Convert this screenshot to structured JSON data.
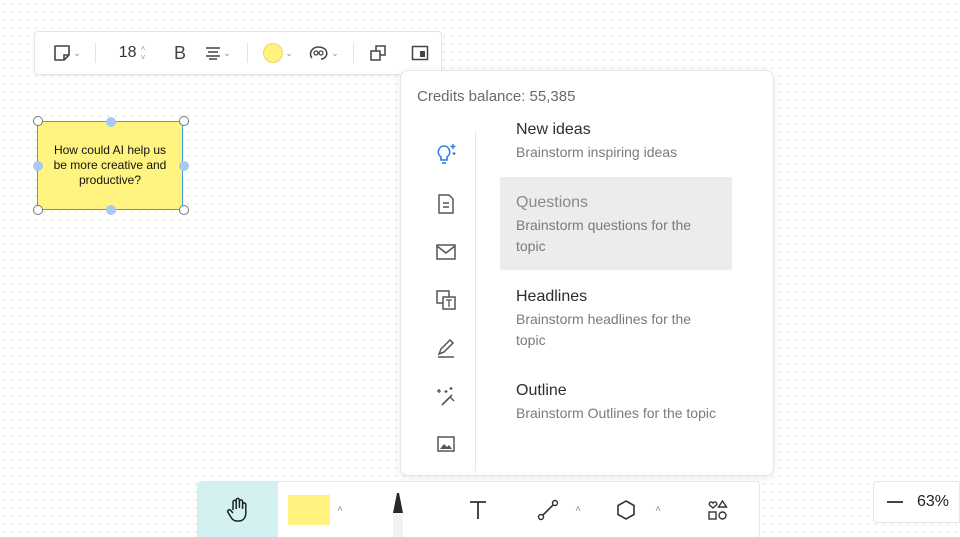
{
  "toolbar": {
    "font_size": "18",
    "bold_label": "B",
    "fill_color": "#fff27f"
  },
  "sticky_note": {
    "text": "How could AI help us be more creative and productive?",
    "color": "#fff47f",
    "selection_color": "#3ea0ec"
  },
  "ai_panel": {
    "credits": "Credits balance: 55,385",
    "side_icons": [
      "lightbulb-sparkle-icon",
      "document-icon",
      "mail-icon",
      "translate-icon",
      "pen-edit-icon",
      "magic-wand-icon",
      "image-icon"
    ],
    "options": [
      {
        "title": "New ideas",
        "desc": "Brainstorm inspiring ideas"
      },
      {
        "title": "Questions",
        "desc": "Brainstorm questions for the topic"
      },
      {
        "title": "Headlines",
        "desc": "Brainstorm headlines for the topic"
      },
      {
        "title": "Outline",
        "desc": "Brainstorm Outlines for the topic"
      }
    ],
    "selected_option": "Questions"
  },
  "bottom_toolbar": {
    "tools": [
      "hand-tool",
      "sticky-note-tool",
      "marker-tool",
      "text-tool",
      "connector-tool",
      "shape-tool",
      "more-shapes-tool"
    ],
    "active_tool": "hand-tool",
    "accent": "#d4f1f2"
  },
  "zoom": {
    "value": "63%"
  }
}
